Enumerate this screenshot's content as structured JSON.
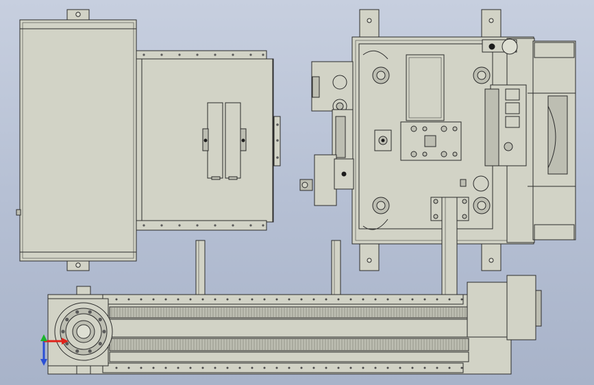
{
  "viewport": {
    "background_top": "#c7cfdf",
    "background_bottom": "#a8b3c9",
    "part_fill": "#d2d3c6",
    "edge_color": "#2b2b2b"
  },
  "triad": {
    "x_color": "#e0231b",
    "y_color": "#19b52b",
    "z_color": "#2a4fd6",
    "x_label": "",
    "y_label": "",
    "z_label": ""
  }
}
